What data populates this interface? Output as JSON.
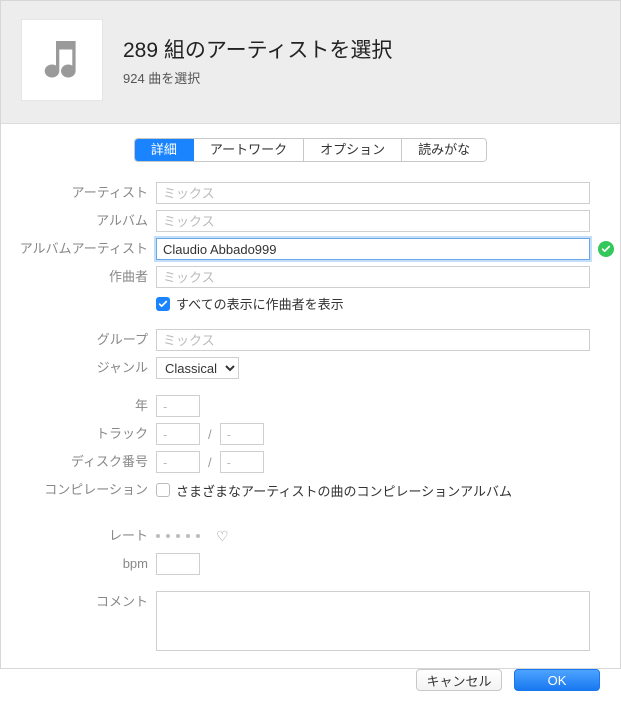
{
  "header": {
    "title": "289 組のアーティストを選択",
    "subtitle": "924 曲を選択"
  },
  "tabs": {
    "detail": "詳細",
    "artwork": "アートワーク",
    "options": "オプション",
    "sorting": "読みがな"
  },
  "labels": {
    "artist": "アーティスト",
    "album": "アルバム",
    "album_artist": "アルバムアーティスト",
    "composer": "作曲者",
    "show_composer": "すべての表示に作曲者を表示",
    "group": "グループ",
    "genre": "ジャンル",
    "year": "年",
    "track": "トラック",
    "disc": "ディスク番号",
    "compilation": "コンピレーション",
    "compilation_cb": "さまざまなアーティストの曲のコンピレーションアルバム",
    "rate": "レート",
    "bpm": "bpm",
    "comment": "コメント"
  },
  "placeholders": {
    "mix": "ミックス",
    "dash": "-"
  },
  "values": {
    "album_artist": "Claudio Abbado999",
    "genre": "Classical"
  },
  "buttons": {
    "cancel": "キャンセル",
    "ok": "OK"
  }
}
